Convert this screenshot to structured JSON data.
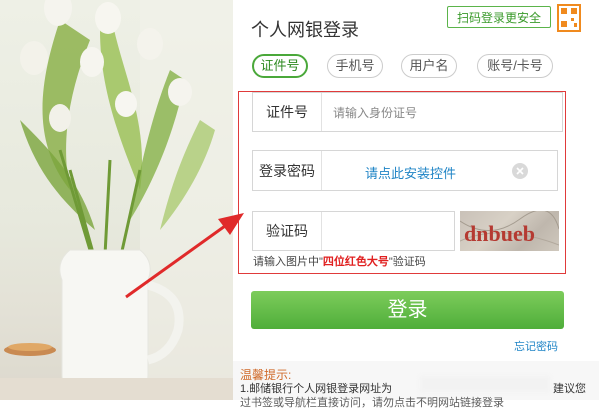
{
  "login": {
    "title": "个人网银登录",
    "scan_label": "扫码登录更安全",
    "tabs": [
      "证件号",
      "手机号",
      "用户名",
      "账号/卡号"
    ],
    "id_label": "证件号",
    "id_placeholder": "请输入身份证号",
    "password_label": "登录密码",
    "install_link": "请点此安装控件",
    "captcha_label": "验证码",
    "captcha_text": "dnbueb",
    "hint_prefix": "请输入图片中\"",
    "hint_emphasis": "四位红色大号",
    "hint_suffix": "\"验证码",
    "login_button": "登录",
    "forgot_link": "忘记密码"
  },
  "notice": {
    "title": "温馨提示:",
    "line1": "1.邮储银行个人网银登录网址为",
    "line1_tail": "建议您",
    "line2": "过书签或导航栏直接访问，请勿点击不明网站链接登录"
  },
  "colors": {
    "brand_green": "#4fae3a",
    "highlight_red": "#e03a3a",
    "link_blue": "#1f84c6",
    "qr_orange": "#f08a1e"
  }
}
